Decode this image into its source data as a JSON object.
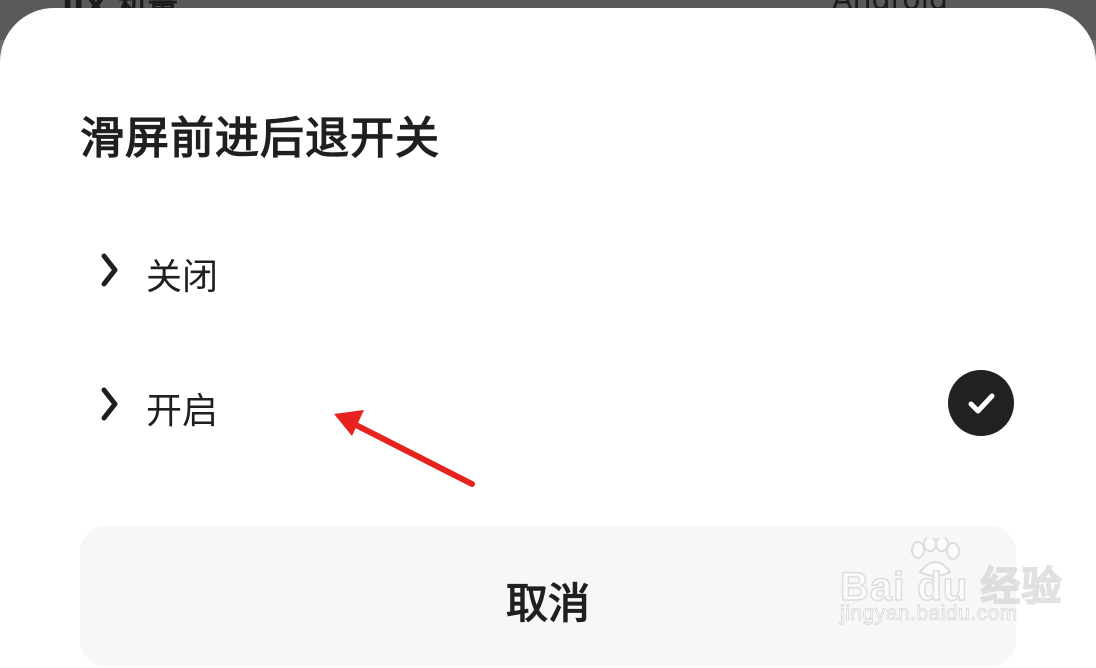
{
  "backdrop": {
    "left_text": "IIX 机量",
    "right_text": "Android"
  },
  "dialog": {
    "title": "滑屏前进后退开关",
    "options": [
      {
        "label": "关闭",
        "selected": false
      },
      {
        "label": "开启",
        "selected": true
      }
    ],
    "cancel_label": "取消"
  },
  "annotation": {
    "arrow_color": "#e8231d"
  },
  "watermark": {
    "brand": "Bai du 经验",
    "url": "jingyan.baidu.com"
  },
  "colors": {
    "sheet_background": "#ffffff",
    "text": "#1f1f1f",
    "check_fill": "#212121",
    "cancel_background": "#f7f7f7",
    "backdrop": "#6f6f6f"
  },
  "icons": {
    "option_indicator": "chevron-right-icon",
    "selected_indicator": "checkmark-icon"
  }
}
